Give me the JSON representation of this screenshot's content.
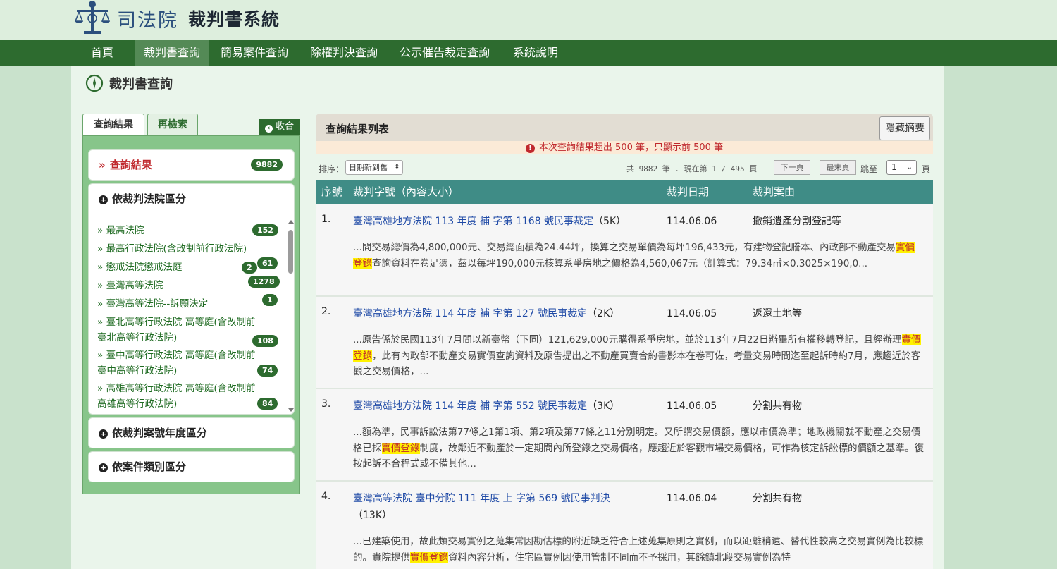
{
  "site": {
    "org": "司法院",
    "system": "裁判書系統"
  },
  "nav": [
    {
      "label": "首頁"
    },
    {
      "label": "裁判書查詢"
    },
    {
      "label": "簡易案件查詢"
    },
    {
      "label": "除權判決查詢"
    },
    {
      "label": "公示催告裁定查詢"
    },
    {
      "label": "系統說明"
    }
  ],
  "page": {
    "title": "裁判書查詢"
  },
  "sidebar": {
    "tabs": [
      {
        "label": "查詢結果"
      },
      {
        "label": "再檢索"
      }
    ],
    "collapse_label": "收合",
    "results": {
      "label": "查詢結果",
      "arrow": "»",
      "count": "9882"
    },
    "court_section": {
      "label": "依裁判法院區分"
    },
    "courts": [
      {
        "line1": "最高法院",
        "line2": "",
        "badges": [
          "152"
        ]
      },
      {
        "line1": "最高行政法院(含改制前行政法院)",
        "line2": "",
        "badges": []
      },
      {
        "line1": "懲戒法院懲戒法庭",
        "line2": "",
        "badges": [
          "2",
          "61"
        ]
      },
      {
        "line1": "臺灣高等法院",
        "line2": "",
        "badges": [
          "1278"
        ]
      },
      {
        "line1": "臺灣高等法院--訴願決定",
        "line2": "",
        "badges": [
          "1"
        ]
      },
      {
        "line1": "臺北高等行政法院 高等庭(含改制前",
        "line2": "臺北高等行政法院)",
        "badges": [
          "108"
        ]
      },
      {
        "line1": "臺中高等行政法院 高等庭(含改制前",
        "line2": "臺中高等行政法院)",
        "badges": [
          "74"
        ]
      },
      {
        "line1": "高雄高等行政法院 高等庭(含改制前",
        "line2": "高雄高等行政法院)",
        "badges": [
          "84"
        ]
      }
    ],
    "year_section": {
      "label": "依裁判案號年度區分"
    },
    "type_section": {
      "label": "依案件類別區分"
    }
  },
  "main": {
    "title": "查詢結果列表",
    "hide_summary_label": "隱藏摘要",
    "notice": "本次查詢結果超出 500 筆，只顯示前 500 筆",
    "sort_label": "排序：",
    "sort_value": "日期新到舊",
    "page_info": "共 9882 筆 . 現在第 1 / 495 頁",
    "next_label": "下一頁",
    "last_label": "最末頁",
    "jump_label": "跳至",
    "page_select": "1",
    "page_unit": "頁",
    "columns": {
      "no": "序號",
      "case": "裁判字號（內容大小）",
      "date": "裁判日期",
      "reason": "裁判案由"
    },
    "rows": [
      {
        "no": "1.",
        "case": "臺灣高雄地方法院 113 年度 補 字第 1168 號民事裁定",
        "size": "（5K）",
        "date": "114.06.06",
        "reason": "撤銷遺產分割登記等",
        "summary_a": "...間交易總價為4,800,000元、交易總面積為24.44坪，換算之交易單價為每坪196,433元，有建物登記謄本、內政部不動產交易",
        "summary_hl": "實價登錄",
        "summary_b": "查詢資料在卷足憑，茲以每坪190,000元核算系爭房地之價格為4,560,067元（計算式：79.34㎡×0.3025×190,0..."
      },
      {
        "no": "2.",
        "case": "臺灣高雄地方法院 114 年度 補 字第 127 號民事裁定",
        "size": "（2K）",
        "date": "114.06.05",
        "reason": "返還土地等",
        "summary_a": "...原告係於民國113年7月間以新臺幣（下同）121,629,000元購得系爭房地，並於113年7月22日辦畢所有權移轉登記，且經辦理",
        "summary_hl": "實價登錄",
        "summary_b": "，此有內政部不動產交易實價查詢資料及原告提出之不動產買賣合約書影本在卷可佐，考量交易時間迄至起訴時約7月，應趨近於客觀之交易價格，..."
      },
      {
        "no": "3.",
        "case": "臺灣高雄地方法院 114 年度 補 字第 552 號民事裁定",
        "size": "（3K）",
        "date": "114.06.05",
        "reason": "分割共有物",
        "summary_a": "...額為準，民事訴訟法第77條之1第1項、第2項及第77條之11分別明定。又所謂交易價額，應以市價為準；地政機關就不動產之交易價格已採",
        "summary_hl": "實價登錄",
        "summary_b": "制度，故鄰近不動產於一定期間內所登錄之交易價格，應趨近於客觀市場交易價格，可作為核定訴訟標的價額之基準。復按起訴不合程式或不備其他..."
      },
      {
        "no": "4.",
        "case": "臺灣高等法院 臺中分院 111 年度 上 字第 569 號民事判決",
        "size": "（13K）",
        "date": "114.06.04",
        "reason": "分割共有物",
        "summary_a": "...已建築使用，故此類交易實例之蒐集常因勘估標的附近缺乏符合上述蒐集原則之實例，而以距離稍遠、替代性較高之交易實例為比較標的。貴院提供",
        "summary_hl": "實價登錄",
        "summary_b": "資料內容分析，住宅區實例因使用管制不同而不予採用，其餘鎮北段交易實例為特"
      }
    ]
  }
}
